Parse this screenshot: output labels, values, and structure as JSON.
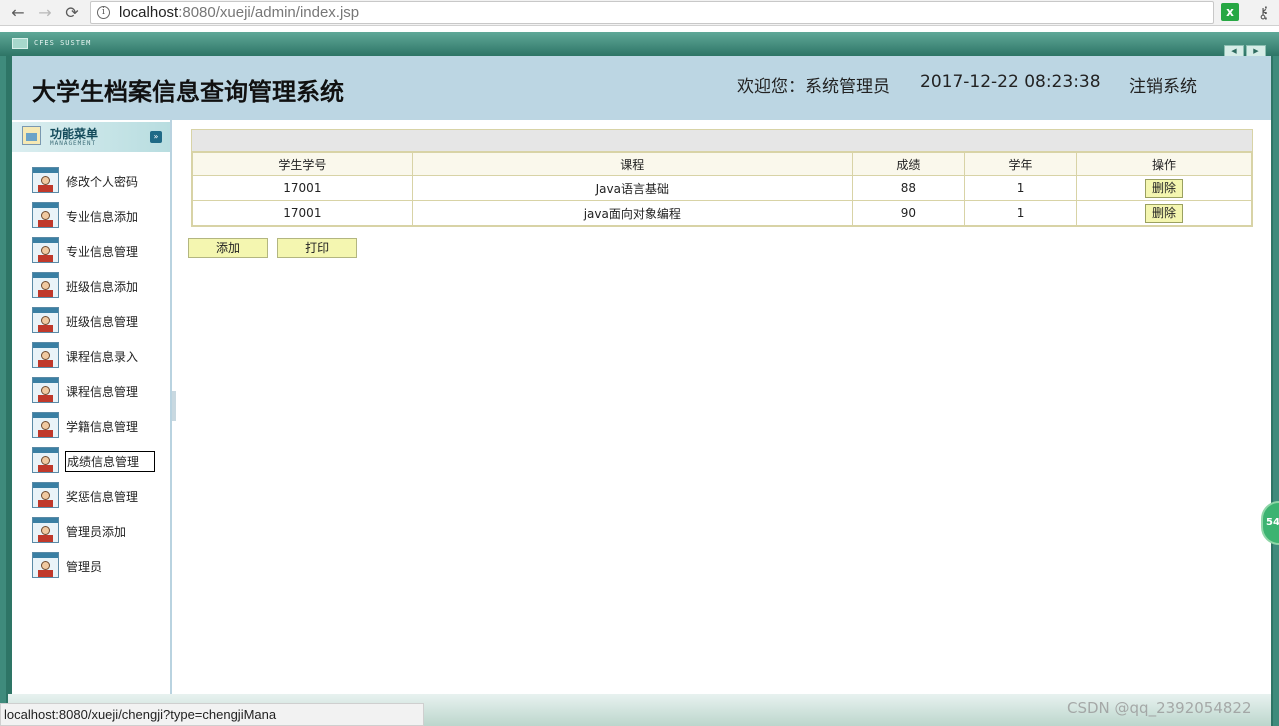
{
  "browser": {
    "url_host": "localhost",
    "url_rest": ":8080/xueji/admin/index.jsp",
    "status_url": "localhost:8080/xueji/chengji?type=chengjiMana"
  },
  "app": {
    "window_title": "CFES SUSTEM",
    "site_title": "大学生档案信息查询管理系统",
    "welcome": "欢迎您：系统管理员",
    "datetime": "2017-12-22 08:23:38",
    "logout": "注销系统"
  },
  "menu": {
    "title": "功能菜单",
    "subtitle": "MANAGEMENT",
    "items": [
      {
        "label": "修改个人密码"
      },
      {
        "label": "专业信息添加"
      },
      {
        "label": "专业信息管理"
      },
      {
        "label": "班级信息添加"
      },
      {
        "label": "班级信息管理"
      },
      {
        "label": "课程信息录入"
      },
      {
        "label": "课程信息管理"
      },
      {
        "label": "学籍信息管理"
      },
      {
        "label": "成绩信息管理"
      },
      {
        "label": "奖惩信息管理"
      },
      {
        "label": "管理员添加"
      },
      {
        "label": "管理员"
      }
    ]
  },
  "table": {
    "headers": [
      "学生学号",
      "课程",
      "成绩",
      "学年",
      "操作"
    ],
    "rows": [
      {
        "student_id": "17001",
        "course": "Java语言基础",
        "score": "88",
        "year": "1",
        "action": "删除"
      },
      {
        "student_id": "17001",
        "course": "java面向对象编程",
        "score": "90",
        "year": "1",
        "action": "删除"
      }
    ]
  },
  "actions": {
    "add": "添加",
    "print": "打印"
  },
  "watermark": "CSDN @qq_2392054822",
  "side_badge": "54",
  "colors": {
    "frame": "#2e7566",
    "header_bg": "#bcd6e3",
    "button_bg": "#f4f6b0"
  }
}
